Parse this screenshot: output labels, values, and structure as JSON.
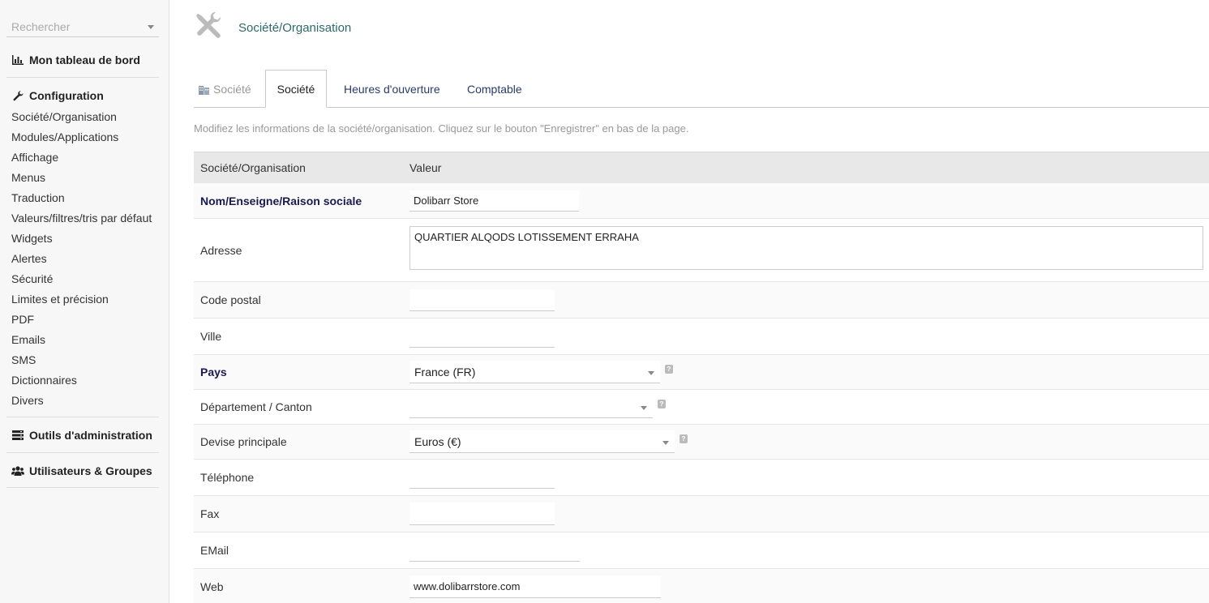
{
  "sidebar": {
    "search_placeholder": "Rechercher",
    "dashboard": "Mon tableau de bord",
    "config_title": "Configuration",
    "config_items": [
      "Société/Organisation",
      "Modules/Applications",
      "Affichage",
      "Menus",
      "Traduction",
      "Valeurs/filtres/tris par défaut",
      "Widgets",
      "Alertes",
      "Sécurité",
      "Limites et précision",
      "PDF",
      "Emails",
      "SMS",
      "Dictionnaires",
      "Divers"
    ],
    "admin_tools": "Outils d'administration",
    "users_groups": "Utilisateurs & Groupes"
  },
  "header": {
    "title": "Société/Organisation"
  },
  "tabs": [
    {
      "label": "Société"
    },
    {
      "label": "Société"
    },
    {
      "label": "Heures d'ouverture"
    },
    {
      "label": "Comptable"
    }
  ],
  "intro": "Modifiez les informations de la société/organisation. Cliquez sur le bouton \"Enregistrer\" en bas de la page.",
  "table": {
    "col1": "Société/Organisation",
    "col2": "Valeur",
    "rows": {
      "name": {
        "label": "Nom/Enseigne/Raison sociale",
        "value": "Dolibarr Store"
      },
      "address": {
        "label": "Adresse",
        "value": "QUARTIER ALQODS LOTISSEMENT ERRAHA"
      },
      "zip": {
        "label": "Code postal",
        "value": ""
      },
      "town": {
        "label": "Ville",
        "value": ""
      },
      "country": {
        "label": "Pays",
        "value": "France (FR)"
      },
      "state": {
        "label": "Département / Canton",
        "value": ""
      },
      "currency": {
        "label": "Devise principale",
        "value": "Euros (€)"
      },
      "phone": {
        "label": "Téléphone",
        "value": ""
      },
      "fax": {
        "label": "Fax",
        "value": ""
      },
      "email": {
        "label": "EMail",
        "value": ""
      },
      "web": {
        "label": "Web",
        "value": "www.dolibarrstore.com"
      }
    }
  },
  "colors": {
    "accent": "#2b6a6a",
    "required_label": "#1a1a4f",
    "tab_text": "#2b3a6b"
  },
  "icons": [
    "chart-icon",
    "wrench-icon",
    "server-icon",
    "users-icon",
    "tools-icon",
    "building-icon",
    "help-icon"
  ]
}
